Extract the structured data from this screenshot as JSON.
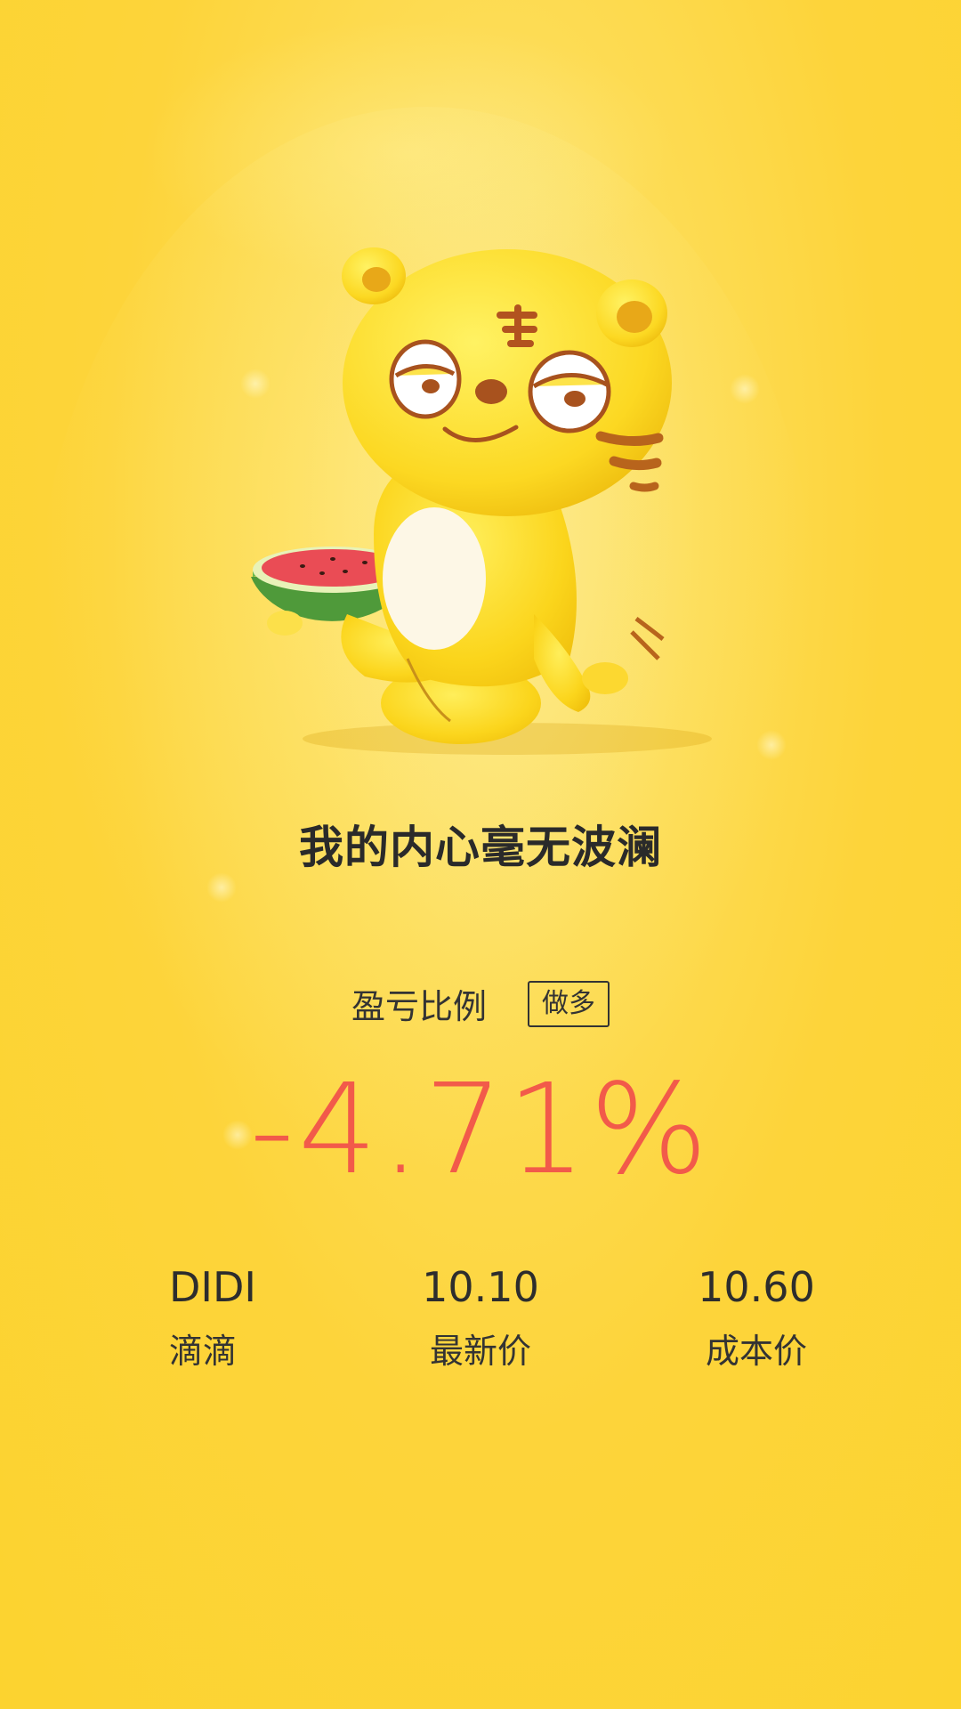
{
  "headline": "我的内心毫无波澜",
  "ratio": {
    "label": "盈亏比例",
    "badge": "做多",
    "value": "-4.71%"
  },
  "stats": [
    {
      "value": "DIDI",
      "label": "滴滴"
    },
    {
      "value": "10.10",
      "label": "最新价"
    },
    {
      "value": "10.60",
      "label": "成本价"
    }
  ],
  "colors": {
    "background": "#fdd43a",
    "loss": "#f25a4a",
    "text": "#2a2a2a"
  },
  "icons": {
    "mascot": "tiger-mascot-icon",
    "watermelon": "watermelon-icon"
  }
}
